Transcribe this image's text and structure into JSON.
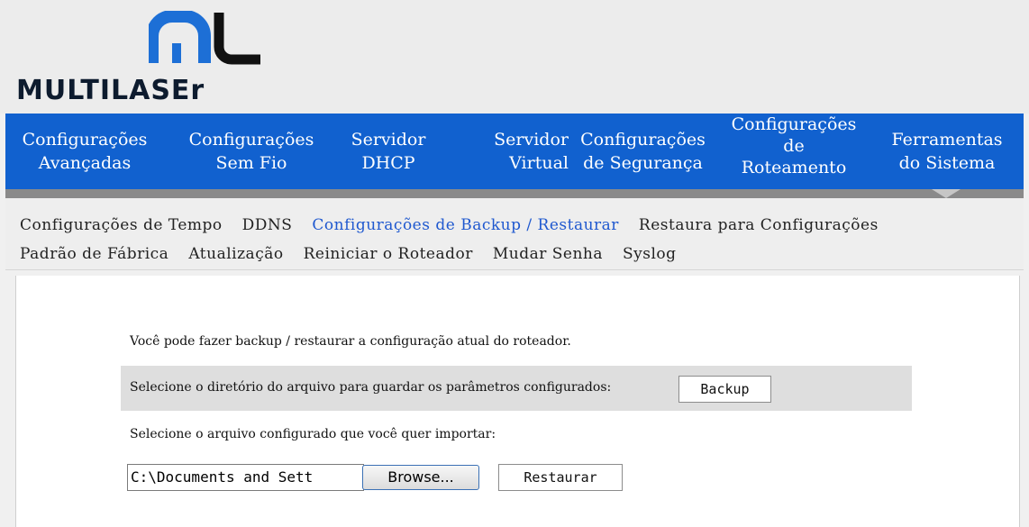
{
  "logo": {
    "text": "MULTILASEr",
    "mark_color": "#1d6fd6",
    "text_color": "#0d1b2e"
  },
  "nav": {
    "items": [
      {
        "line1": "Configurações",
        "line2": "Avançadas"
      },
      {
        "line1": "Configurações",
        "line2": "Sem Fio"
      },
      {
        "line1": "Servidor",
        "line2": "DHCP"
      },
      {
        "line1": "Servidor",
        "line2": "Virtual"
      },
      {
        "line1": "Configurações",
        "line2": "de Segurança"
      },
      {
        "line1": "Configurações",
        "line2": "de",
        "line3": "Roteamento"
      },
      {
        "line1": "Ferramentas",
        "line2": "do Sistema"
      }
    ],
    "background": "#1161cf"
  },
  "subnav": {
    "items": [
      "Configurações de Tempo",
      "DDNS",
      "Configurações de Backup / Restaurar",
      "Restaura para Configurações Padrão de Fábrica",
      "Atualização",
      "Reiniciar o Roteador",
      "Mudar Senha",
      "Syslog"
    ],
    "active_index": 2,
    "active_color": "#1f58cf"
  },
  "content": {
    "intro": "Você pode fazer backup / restaurar a configuração atual do roteador.",
    "backup_label": "Selecione o diretório do arquivo para guardar os parâmetros configurados:",
    "backup_button": "Backup",
    "import_label": "Selecione o arquivo configurado que você quer importar:",
    "file_value": "C:\\Documents and Sett",
    "browse_button": "Browse...",
    "restore_button": "Restaurar"
  }
}
